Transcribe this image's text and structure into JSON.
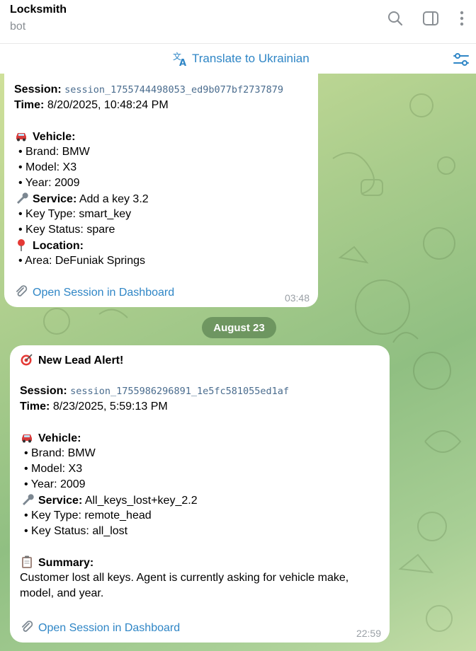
{
  "header": {
    "title": "Locksmith",
    "subtitle": "bot",
    "icons": [
      "search-icon",
      "sidebar-toggle-icon",
      "more-vertical-icon"
    ]
  },
  "translate_bar": {
    "label": "Translate to Ukrainian",
    "icons": [
      "translate-icon",
      "settings-icon"
    ]
  },
  "messages": [
    {
      "session_label": "Session:",
      "session_id": "session_1755744498053_ed9b077bf2737879",
      "time_label": "Time:",
      "time_value": "8/20/2025, 10:48:24 PM",
      "vehicle_heading": "Vehicle:",
      "brand": "• Brand: BMW",
      "model": "• Model: X3",
      "year": "• Year: 2009",
      "service_label": "Service:",
      "service_value": "Add a key 3.2",
      "key_type": "• Key Type: smart_key",
      "key_status": "• Key Status: spare",
      "location_heading": "Location:",
      "area": "• Area: DeFuniak Springs",
      "link": "Open Session in Dashboard",
      "timestamp": "03:48"
    },
    {
      "alert_title": "New Lead Alert!",
      "session_label": "Session:",
      "session_id": "session_1755986296891_1e5fc581055ed1af",
      "time_label": "Time:",
      "time_value": "8/23/2025, 5:59:13 PM",
      "vehicle_heading": "Vehicle:",
      "brand": "• Brand: BMW",
      "model": "• Model: X3",
      "year": "• Year: 2009",
      "service_label": "Service:",
      "service_value": "All_keys_lost+key_2.2",
      "key_type": "• Key Type: remote_head",
      "key_status": "• Key Status: all_lost",
      "summary_heading": "Summary:",
      "summary_line1": "Customer lost all keys. Agent is currently asking for vehicle make,",
      "summary_line2": "model, and year.",
      "link": "Open Session in Dashboard",
      "timestamp": "22:59"
    }
  ],
  "date_separator": "August 23",
  "colors": {
    "accent": "#2f86c6",
    "bubble": "#ffffff",
    "date_pill": "#5c8452",
    "session_id": "#4a6c8e"
  }
}
